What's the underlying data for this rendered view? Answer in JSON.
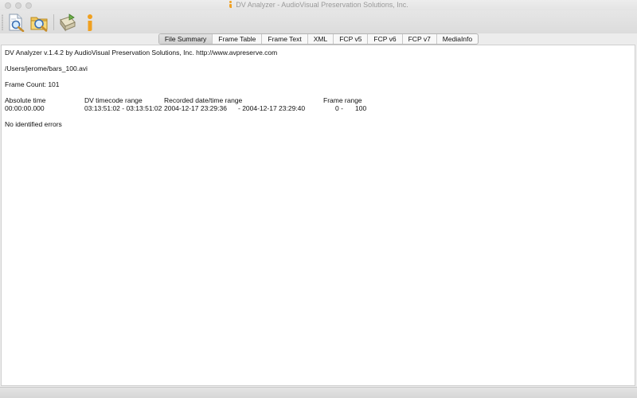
{
  "window": {
    "title": "DV Analyzer - AudioVisual Preservation Solutions, Inc."
  },
  "toolbar": {
    "items": [
      {
        "icon": "open-file-magnifier-icon"
      },
      {
        "icon": "open-folder-magnifier-icon"
      },
      {
        "icon": "export-icon"
      },
      {
        "icon": "info-i-icon"
      }
    ]
  },
  "tabs": [
    {
      "label": "File Summary",
      "active": true
    },
    {
      "label": "Frame Table",
      "active": false
    },
    {
      "label": "Frame Text",
      "active": false
    },
    {
      "label": "XML",
      "active": false
    },
    {
      "label": "FCP v5",
      "active": false
    },
    {
      "label": "FCP v6",
      "active": false
    },
    {
      "label": "FCP v7",
      "active": false
    },
    {
      "label": "MediaInfo",
      "active": false
    }
  ],
  "report": {
    "header": "DV Analyzer v.1.4.2 by AudioVisual Preservation Solutions, Inc. http://www.avpreserve.com",
    "file_path": "/Users/jerome/bars_100.avi",
    "frame_count": "Frame Count: 101",
    "columns": {
      "absolute_time": "Absolute time",
      "dv_timecode_range": "DV timecode range",
      "recorded_range": "Recorded date/time range",
      "frame_range": "Frame range"
    },
    "row": {
      "absolute_time": "00:00:00.000",
      "dv_timecode_range": "03:13:51:02 - 03:13:51:02",
      "recorded_start": "2004-12-17 23:29:36",
      "recorded_end": "- 2004-12-17 23:29:40",
      "frame_start": "0 -",
      "frame_end": "100"
    },
    "errors": "No identified errors"
  },
  "colors": {
    "accent_orange": "#f0a020",
    "content_bg": "#ffffff",
    "chrome_bg": "#ececec"
  }
}
